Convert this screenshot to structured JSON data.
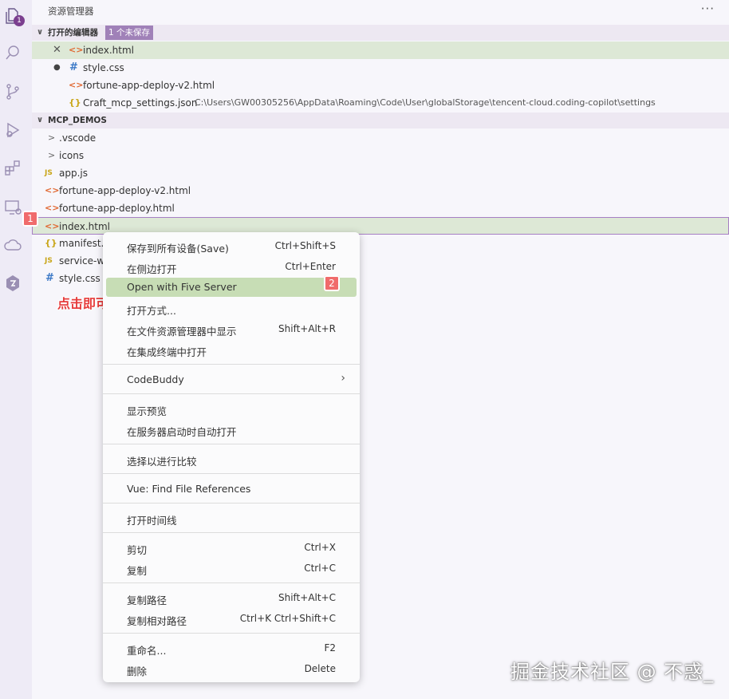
{
  "explorer": {
    "title": "资源管理器",
    "more": "···",
    "activity_badge": "1"
  },
  "open_editors": {
    "header": "打开的编辑器",
    "badge": "1 个未保存",
    "items": [
      {
        "name": "index.html",
        "icon": "<>",
        "marker": "✕"
      },
      {
        "name": "style.css",
        "icon": "#",
        "marker": "●"
      },
      {
        "name": "fortune-app-deploy-v2.html",
        "icon": "<>"
      },
      {
        "name": "Craft_mcp_settings.json",
        "icon": "{}",
        "path": "C:\\Users\\GW00305256\\AppData\\Roaming\\Code\\User\\globalStorage\\tencent-cloud.coding-copilot\\settings"
      }
    ]
  },
  "workspace": {
    "header": "MCP_DEMOS",
    "items": [
      {
        "name": ".vscode",
        "icon": ">"
      },
      {
        "name": "icons",
        "icon": ">"
      },
      {
        "name": "app.js",
        "icon": "JS"
      },
      {
        "name": "fortune-app-deploy-v2.html",
        "icon": "<>"
      },
      {
        "name": "fortune-app-deploy.html",
        "icon": "<>"
      },
      {
        "name": "index.html",
        "icon": "<>"
      },
      {
        "name": "manifest.j",
        "icon": "{}"
      },
      {
        "name": "service-w",
        "icon": "JS"
      },
      {
        "name": "style.css",
        "icon": "#"
      }
    ]
  },
  "steps": {
    "one": "1",
    "two": "2"
  },
  "callout": "点击即可",
  "context_menu": {
    "items": [
      {
        "label": "保存到所有设备(Save)",
        "key": "Ctrl+Shift+S"
      },
      {
        "label": "在侧边打开",
        "key": "Ctrl+Enter"
      },
      {
        "label": "Open with Five Server",
        "key": ""
      },
      {
        "label": "打开方式...",
        "key": ""
      },
      {
        "label": "在文件资源管理器中显示",
        "key": "Shift+Alt+R"
      },
      {
        "label": "在集成终端中打开",
        "key": ""
      },
      {
        "label": "CodeBuddy",
        "key": "",
        "submenu": "›"
      },
      {
        "label": "显示预览",
        "key": ""
      },
      {
        "label": "在服务器启动时自动打开",
        "key": ""
      },
      {
        "label": "选择以进行比较",
        "key": ""
      },
      {
        "label": "Vue: Find File References",
        "key": ""
      },
      {
        "label": "打开时间线",
        "key": ""
      },
      {
        "label": "剪切",
        "key": "Ctrl+X"
      },
      {
        "label": "复制",
        "key": "Ctrl+C"
      },
      {
        "label": "复制路径",
        "key": "Shift+Alt+C"
      },
      {
        "label": "复制相对路径",
        "key": "Ctrl+K Ctrl+Shift+C"
      },
      {
        "label": "重命名...",
        "key": "F2"
      },
      {
        "label": "删除",
        "key": "Delete"
      }
    ]
  },
  "watermark": "掘金技术社区 @ 不惑_",
  "colors": {
    "accent": "#a77fc4",
    "highlight": "#c7ddb5",
    "step": "#f06b6b",
    "callout": "#e63b3b"
  }
}
